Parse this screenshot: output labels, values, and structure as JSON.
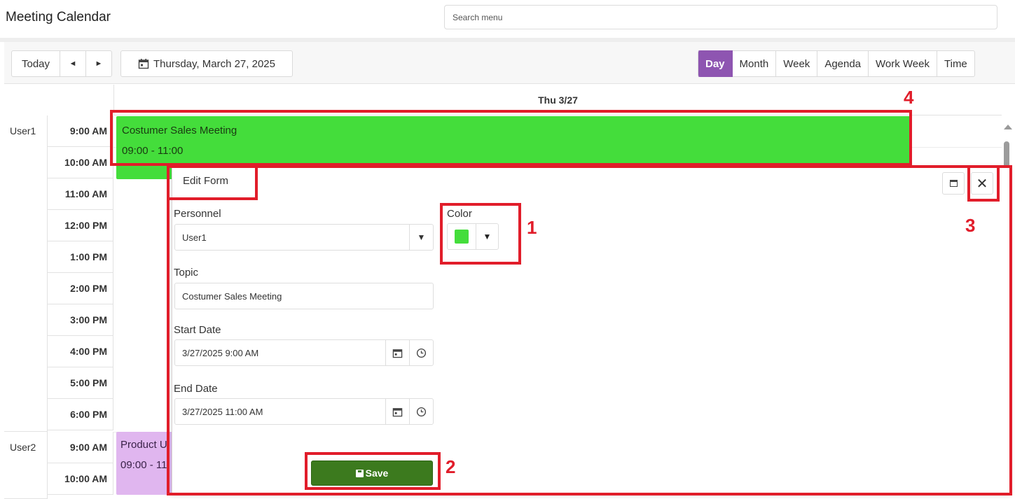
{
  "app": {
    "title": "Meeting Calendar",
    "search_placeholder": "Search menu"
  },
  "toolbar": {
    "today_label": "Today",
    "prev_glyph": "◄",
    "next_glyph": "►",
    "date_label": "Thursday, March 27, 2025",
    "views": [
      "Day",
      "Month",
      "Week",
      "Agenda",
      "Work Week",
      "Time"
    ],
    "active_view": "Day"
  },
  "calendar": {
    "day_header": "Thu 3/27",
    "resources": [
      {
        "name": "User1",
        "times": [
          "9:00 AM",
          "10:00 AM",
          "11:00 AM",
          "12:00 PM",
          "1:00 PM",
          "2:00 PM",
          "3:00 PM",
          "4:00 PM",
          "5:00 PM",
          "6:00 PM"
        ]
      },
      {
        "name": "User2",
        "times": [
          "9:00 AM",
          "10:00 AM"
        ]
      }
    ],
    "events": [
      {
        "title": "Costumer Sales Meeting",
        "time": "09:00 - 11:00",
        "color": "#44dd3b"
      },
      {
        "title": "Product U",
        "time": "09:00 - 11",
        "color": "#e0b6ef"
      }
    ]
  },
  "edit_form": {
    "title": "Edit Form",
    "personnel_label": "Personnel",
    "personnel_value": "User1",
    "color_label": "Color",
    "color_value": "#44dd3b",
    "topic_label": "Topic",
    "topic_value": "Costumer Sales Meeting",
    "start_label": "Start Date",
    "start_value": "3/27/2025 9:00 AM",
    "end_label": "End Date",
    "end_value": "3/27/2025 11:00 AM",
    "save_label": "Save",
    "close_glyph": "✕"
  },
  "annotations": {
    "color_number": "1",
    "save_number": "2",
    "close_number": "3",
    "event_number": "4",
    "highlight_color": "#e11d2a"
  }
}
